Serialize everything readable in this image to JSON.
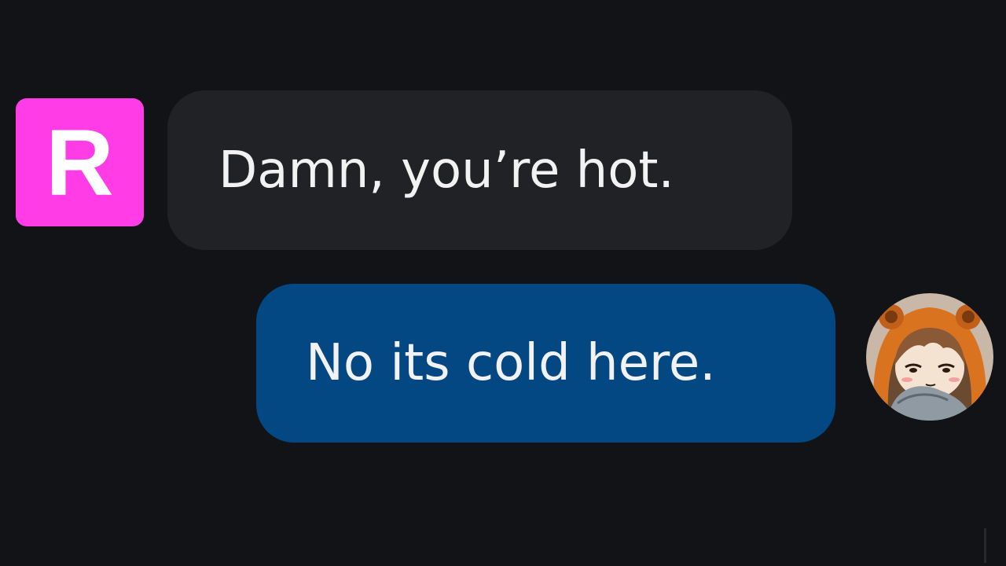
{
  "conversation": {
    "messages": [
      {
        "sender": "R",
        "text": "Damn, you’re hot."
      },
      {
        "text": "No its cold here."
      }
    ]
  },
  "colors": {
    "background": "#121316",
    "incoming_bubble": "#202226",
    "outgoing_bubble": "#034883",
    "r_avatar": "#ff3ce6",
    "text": "#f2f2f2"
  },
  "icons": {
    "incoming_avatar": "letter-r-avatar",
    "outgoing_avatar": "anime-girl-hood-avatar"
  }
}
